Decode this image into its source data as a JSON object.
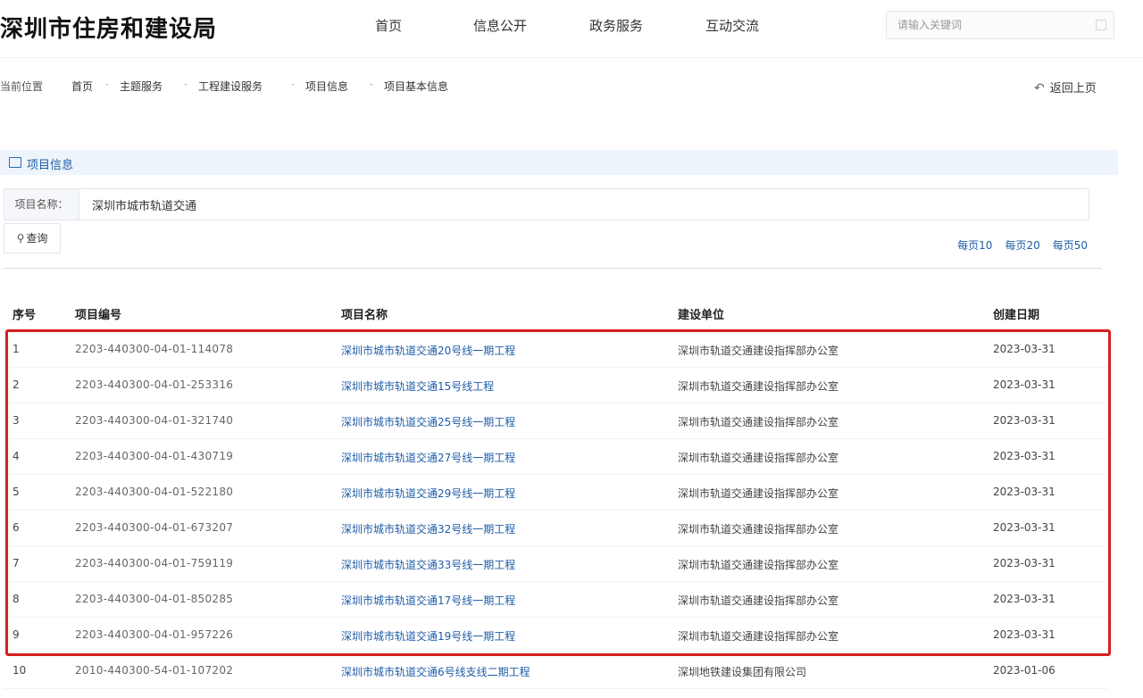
{
  "header": {
    "site_title": "深圳市住房和建设局",
    "nav": [
      "首页",
      "信息公开",
      "政务服务",
      "互动交流"
    ],
    "search_placeholder": "请输入关键词"
  },
  "breadcrumb": {
    "label": "当前位置",
    "items": [
      "首页",
      "主题服务",
      "工程建设服务",
      "项目信息",
      "项目基本信息"
    ],
    "separator": "·"
  },
  "back_link": {
    "icon": "return-arrow-icon",
    "label": "返回上页"
  },
  "section": {
    "icon": "window-icon",
    "title": "项目信息"
  },
  "filter": {
    "label": "项目名称：",
    "value": "深圳市城市轨道交通"
  },
  "query_button": {
    "icon": "search-icon",
    "label": "查询"
  },
  "page_sizes": [
    "每页10",
    "每页20",
    "每页50"
  ],
  "table": {
    "headers": [
      "序号",
      "项目编号",
      "项目名称",
      "建设单位",
      "创建日期"
    ],
    "rows": [
      {
        "no": "1",
        "code": "2203-440300-04-01-114078",
        "name": "深圳市城市轨道交通20号线一期工程",
        "unit": "深圳市轨道交通建设指挥部办公室",
        "date": "2023-03-31"
      },
      {
        "no": "2",
        "code": "2203-440300-04-01-253316",
        "name": "深圳市城市轨道交通15号线工程",
        "unit": "深圳市轨道交通建设指挥部办公室",
        "date": "2023-03-31"
      },
      {
        "no": "3",
        "code": "2203-440300-04-01-321740",
        "name": "深圳市城市轨道交通25号线一期工程",
        "unit": "深圳市轨道交通建设指挥部办公室",
        "date": "2023-03-31"
      },
      {
        "no": "4",
        "code": "2203-440300-04-01-430719",
        "name": "深圳市城市轨道交通27号线一期工程",
        "unit": "深圳市轨道交通建设指挥部办公室",
        "date": "2023-03-31"
      },
      {
        "no": "5",
        "code": "2203-440300-04-01-522180",
        "name": "深圳市城市轨道交通29号线一期工程",
        "unit": "深圳市轨道交通建设指挥部办公室",
        "date": "2023-03-31"
      },
      {
        "no": "6",
        "code": "2203-440300-04-01-673207",
        "name": "深圳市城市轨道交通32号线一期工程",
        "unit": "深圳市轨道交通建设指挥部办公室",
        "date": "2023-03-31"
      },
      {
        "no": "7",
        "code": "2203-440300-04-01-759119",
        "name": "深圳市城市轨道交通33号线一期工程",
        "unit": "深圳市轨道交通建设指挥部办公室",
        "date": "2023-03-31"
      },
      {
        "no": "8",
        "code": "2203-440300-04-01-850285",
        "name": "深圳市城市轨道交通17号线一期工程",
        "unit": "深圳市轨道交通建设指挥部办公室",
        "date": "2023-03-31"
      },
      {
        "no": "9",
        "code": "2203-440300-04-01-957226",
        "name": "深圳市城市轨道交通19号线一期工程",
        "unit": "深圳市轨道交通建设指挥部办公室",
        "date": "2023-03-31"
      },
      {
        "no": "10",
        "code": "2010-440300-54-01-107202",
        "name": "深圳市城市轨道交通6号线支线二期工程",
        "unit": "深圳地铁建设集团有限公司",
        "date": "2023-01-06"
      }
    ]
  },
  "colors": {
    "accent": "#1f5da8",
    "highlight": "#d62020"
  }
}
